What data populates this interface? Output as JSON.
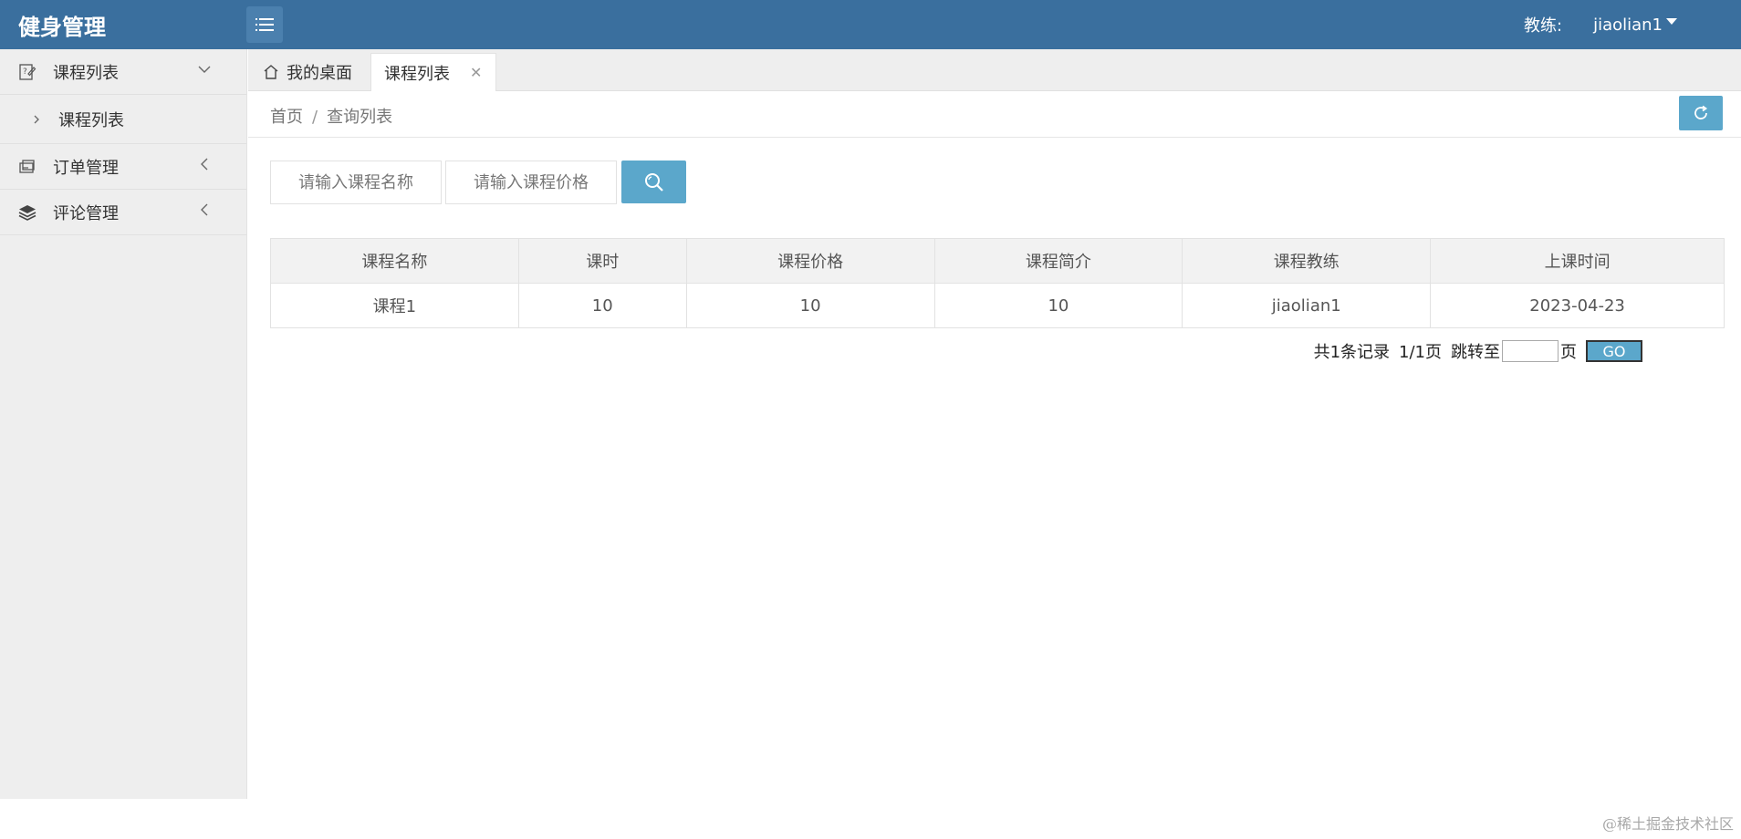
{
  "header": {
    "app_title": "健身管理",
    "role_label": "教练:",
    "username": "jiaolian1"
  },
  "sidebar": {
    "groups": [
      {
        "label": "课程列表",
        "icon": "course-edit-icon",
        "expanded": true,
        "children": [
          {
            "label": "课程列表"
          }
        ]
      },
      {
        "label": "订单管理",
        "icon": "order-icon",
        "expanded": false
      },
      {
        "label": "评论管理",
        "icon": "layers-icon",
        "expanded": false
      }
    ]
  },
  "tabs": {
    "home_label": "我的桌面",
    "active_label": "课程列表"
  },
  "breadcrumb": {
    "home": "首页",
    "current": "查询列表"
  },
  "search": {
    "name_placeholder": "请输入课程名称",
    "price_placeholder": "请输入课程价格"
  },
  "table": {
    "columns": [
      "课程名称",
      "课时",
      "课程价格",
      "课程简介",
      "课程教练",
      "上课时间"
    ],
    "rows": [
      [
        "课程1",
        "10",
        "10",
        "10",
        "jiaolian1",
        "2023-04-23"
      ]
    ]
  },
  "pagination": {
    "total_text": "共1条记录",
    "page_text": "1/1页",
    "jump_label": "跳转至",
    "page_suffix": "页",
    "go_label": "GO"
  },
  "footer": {
    "credit": "@稀土掘金技术社区"
  },
  "colors": {
    "header_bg": "#3a6f9e",
    "accent": "#5ba7cb",
    "sidebar_bg": "#eeeeee"
  }
}
